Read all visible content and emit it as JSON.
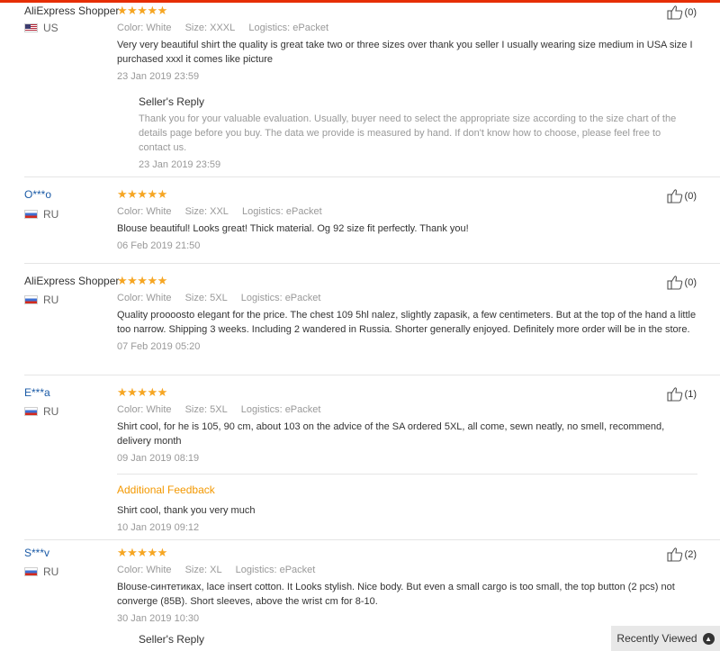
{
  "reviews": [
    {
      "user": "AliExpress Shopper",
      "user_is_link": false,
      "country": "US",
      "flag": "us",
      "stars": "★★★★★",
      "rating": 5,
      "color_label": "Color:",
      "color_value": "White",
      "size_label": "Size:",
      "size_value": "XXXL",
      "logistics_label": "Logistics:",
      "logistics_value": "ePacket",
      "text": "Very very beautiful shirt the quality is great take two or three sizes over thank you seller I usually wearing size medium in USA size I purchased xxxl it comes like picture",
      "date": "23 Jan 2019 23:59",
      "helpful": "(0)",
      "reply_title": "Seller's Reply",
      "reply_text": "Thank you for your valuable evaluation. Usually, buyer need to select the appropriate size according to the size chart of the details page before you buy. The data we provide is measured by hand. If don't know how to choose, please feel free to contact us.",
      "reply_date": "23 Jan 2019 23:59"
    },
    {
      "user": "O***o",
      "user_is_link": true,
      "country": "RU",
      "flag": "ru",
      "stars": "★★★★★",
      "rating": 5,
      "color_label": "Color:",
      "color_value": "White",
      "size_label": "Size:",
      "size_value": "XXL",
      "logistics_label": "Logistics:",
      "logistics_value": "ePacket",
      "text": "Blouse beautiful! Looks great! Thick material. Og 92 size fit perfectly. Thank you!",
      "date": "06 Feb 2019 21:50",
      "helpful": "(0)"
    },
    {
      "user": "AliExpress Shopper",
      "user_is_link": false,
      "country": "RU",
      "flag": "ru",
      "stars": "★★★★★",
      "rating": 5,
      "color_label": "Color:",
      "color_value": "White",
      "size_label": "Size:",
      "size_value": "5XL",
      "logistics_label": "Logistics:",
      "logistics_value": "ePacket",
      "text": "Quality proooosto elegant for the price. The chest 109 5hl nalez, slightly zapasik, a few centimeters. But at the top of the hand a little too narrow. Shipping 3 weeks. Including 2 wandered in Russia. Shorter generally enjoyed. Definitely more order will be in the store.",
      "date": "07 Feb 2019 05:20",
      "helpful": "(0)"
    },
    {
      "user": "E***a",
      "user_is_link": true,
      "country": "RU",
      "flag": "ru",
      "stars": "★★★★★",
      "rating": 5,
      "color_label": "Color:",
      "color_value": "White",
      "size_label": "Size:",
      "size_value": "5XL",
      "logistics_label": "Logistics:",
      "logistics_value": "ePacket",
      "text": "Shirt cool, for he is 105, 90 cm, about 103 on the advice of the SA ordered 5XL, all come, sewn neatly, no smell, recommend, delivery month",
      "date": "09 Jan 2019 08:19",
      "helpful": "(1)",
      "additional_title": "Additional Feedback",
      "additional_text": "Shirt cool, thank you very much",
      "additional_date": "10 Jan 2019 09:12"
    },
    {
      "user": "S***v",
      "user_is_link": true,
      "country": "RU",
      "flag": "ru",
      "stars": "★★★★★",
      "rating": 5,
      "color_label": "Color:",
      "color_value": "White",
      "size_label": "Size:",
      "size_value": "XL",
      "logistics_label": "Logistics:",
      "logistics_value": "ePacket",
      "text": "Blouse-синтетиках, lace insert cotton. It Looks stylish. Nice body. But even a small cargo is too small, the top button (2 pcs) not converge (85B). Short sleeves, above the wrist cm for 8-10.",
      "date": "30 Jan 2019 10:30",
      "helpful": "(2)",
      "reply_title": "Seller's Reply"
    }
  ],
  "recently_viewed": {
    "label": "Recently Viewed",
    "icon": "chevron-up-icon"
  },
  "colors": {
    "accent_top": "#e62e04",
    "star": "#f6a623",
    "user_link": "#1a5aa6",
    "additional_feedback": "#f39800"
  }
}
